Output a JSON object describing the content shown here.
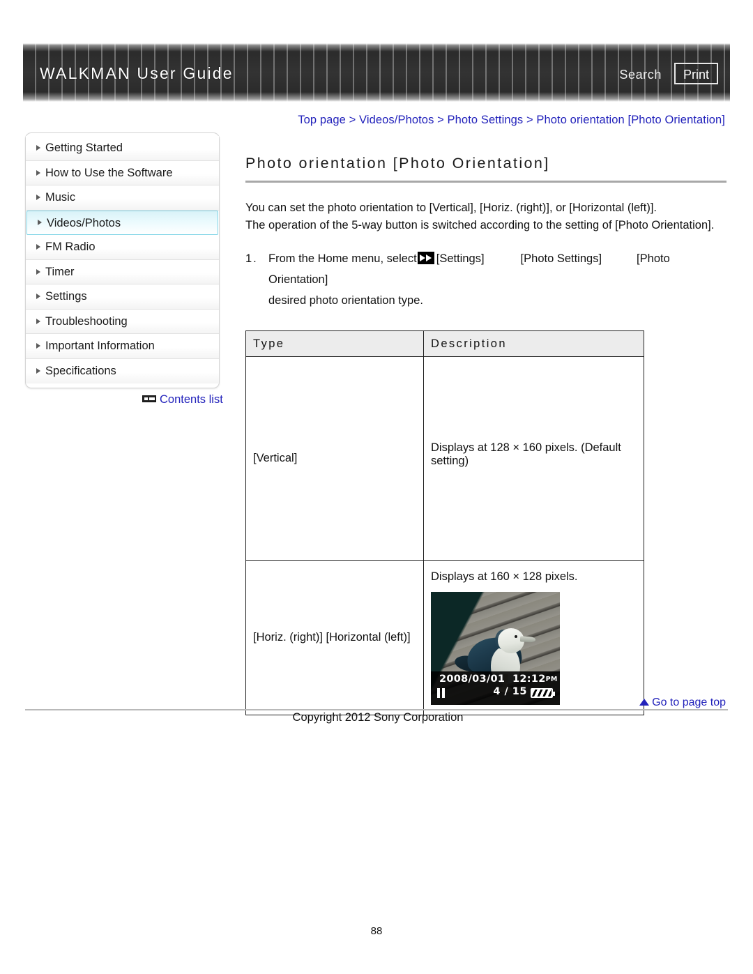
{
  "header": {
    "title": "WALKMAN User Guide",
    "search_label": "Search",
    "print_label": "Print"
  },
  "breadcrumb": {
    "text": "Top page > Videos/Photos > Photo Settings > Photo orientation [Photo Orientation]"
  },
  "sidebar": {
    "items": [
      {
        "label": "Getting Started",
        "active": false
      },
      {
        "label": "How to Use the Software",
        "active": false
      },
      {
        "label": "Music",
        "active": false
      },
      {
        "label": "Videos/Photos",
        "active": true
      },
      {
        "label": "FM Radio",
        "active": false
      },
      {
        "label": "Timer",
        "active": false
      },
      {
        "label": "Settings",
        "active": false
      },
      {
        "label": "Troubleshooting",
        "active": false
      },
      {
        "label": "Important Information",
        "active": false
      },
      {
        "label": "Specifications",
        "active": false
      }
    ],
    "contents_list_label": "Contents list"
  },
  "main": {
    "page_title": "Photo orientation [Photo Orientation]",
    "intro_line1": "You can set the photo orientation to [Vertical], [Horiz. (right)], or [Horizontal (left)].",
    "intro_line2": "The operation of the 5-way button is switched according to the setting of [Photo Orientation].",
    "step": {
      "number": "1.",
      "text_before_icon": "From the Home menu, select",
      "settings_label": "[Settings]",
      "photo_settings_label": "[Photo Settings]",
      "photo_orientation_label": "[Photo Orientation]",
      "text_line2": "desired photo orientation type."
    },
    "table": {
      "headers": [
        "Type",
        "Description"
      ],
      "rows": [
        {
          "type": "[Vertical]",
          "description": "Displays at 128 × 160 pixels. (Default setting)",
          "has_image": false
        },
        {
          "type": "[Horiz. (right)] [Horizontal (left)]",
          "description": "Displays at 160 × 128 pixels.",
          "has_image": true
        }
      ]
    },
    "photo_overlay": {
      "date": "2008/03/01",
      "time": "12:12",
      "ampm": "PM",
      "counter": "4 / 15"
    }
  },
  "footer": {
    "go_to_top_label": "Go to page top",
    "copyright": "Copyright 2012 Sony Corporation",
    "page_number": "88"
  },
  "colors": {
    "link_blue": "#2222bb",
    "header_dark": "#2f2f2f",
    "active_nav_cyan": "#7fd4e6",
    "table_header_bg": "#ececec"
  }
}
